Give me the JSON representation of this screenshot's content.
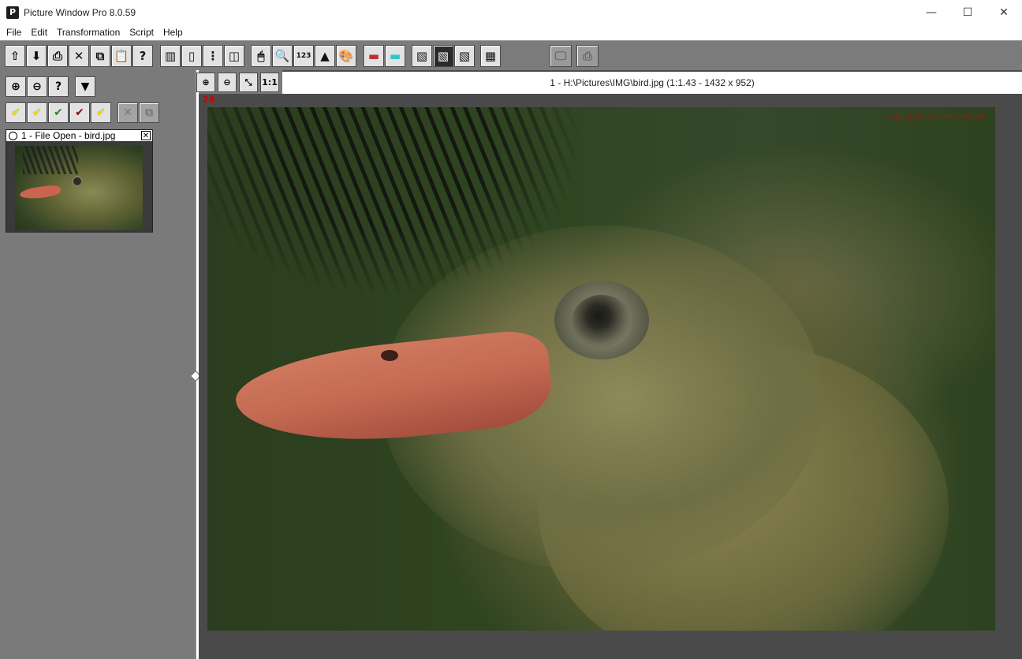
{
  "window": {
    "title": "Picture Window Pro 8.0.59",
    "app_icon_glyph": "P",
    "controls": {
      "minimize": "—",
      "maximize": "☐",
      "close": "✕"
    }
  },
  "menu": [
    "File",
    "Edit",
    "Transformation",
    "Script",
    "Help"
  ],
  "toolbar": {
    "buttons": [
      {
        "name": "open-file-icon",
        "glyph": "⇧"
      },
      {
        "name": "save-file-icon",
        "glyph": "⬇"
      },
      {
        "name": "print-icon",
        "glyph": "⎙"
      },
      {
        "name": "close-file-icon",
        "glyph": "✕"
      },
      {
        "name": "copy-icon",
        "glyph": "⧉"
      },
      {
        "name": "paste-icon",
        "glyph": "📋"
      },
      {
        "name": "help-icon",
        "glyph": "?"
      },
      {
        "name": "filmstrip-icon",
        "glyph": "▥"
      },
      {
        "name": "single-view-icon",
        "glyph": "▯"
      },
      {
        "name": "dotted-view-icon",
        "glyph": "⋮"
      },
      {
        "name": "panel-view-icon",
        "glyph": "◫"
      },
      {
        "name": "mouse-icon",
        "glyph": "🖱"
      },
      {
        "name": "magnifier-icon",
        "glyph": "🔍"
      },
      {
        "name": "readout-icon",
        "glyph": "123"
      },
      {
        "name": "histogram-icon",
        "glyph": "▲"
      },
      {
        "name": "palette-icon",
        "glyph": "🎨"
      },
      {
        "name": "gradient-red-icon",
        "glyph": "▬"
      },
      {
        "name": "gradient-cyan-icon",
        "glyph": "▬"
      },
      {
        "name": "hatch-1-icon",
        "glyph": "▧"
      },
      {
        "name": "hatch-2-icon",
        "glyph": "▧"
      },
      {
        "name": "hatch-3-icon",
        "glyph": "▧"
      },
      {
        "name": "grid-icon",
        "glyph": "▦"
      },
      {
        "name": "monitor-icon",
        "glyph": "🖵"
      },
      {
        "name": "printer-disabled-icon",
        "glyph": "⎙"
      }
    ]
  },
  "left_panel": {
    "zoom_in_glyph": "⊕",
    "zoom_out_glyph": "⊖",
    "help_glyph": "?",
    "dropdown_glyph": "▼",
    "check_glyph": "✔",
    "remove_glyph": "✕",
    "copy_glyph": "⧉",
    "history_item": {
      "label": "1 - File Open - bird.jpg",
      "close_glyph": "✕"
    }
  },
  "image_window": {
    "caption": "1 - H:\\Pictures\\IMG\\bird.jpg (1:1.43 - 1432 x 952)",
    "zoom_in_glyph": "⊕",
    "zoom_out_glyph": "⊖",
    "fit_glyph": "⤡",
    "actual_size_label": "1:1",
    "layer_number": "24",
    "copyright": "Copyright (C) Ken Dedrick"
  }
}
